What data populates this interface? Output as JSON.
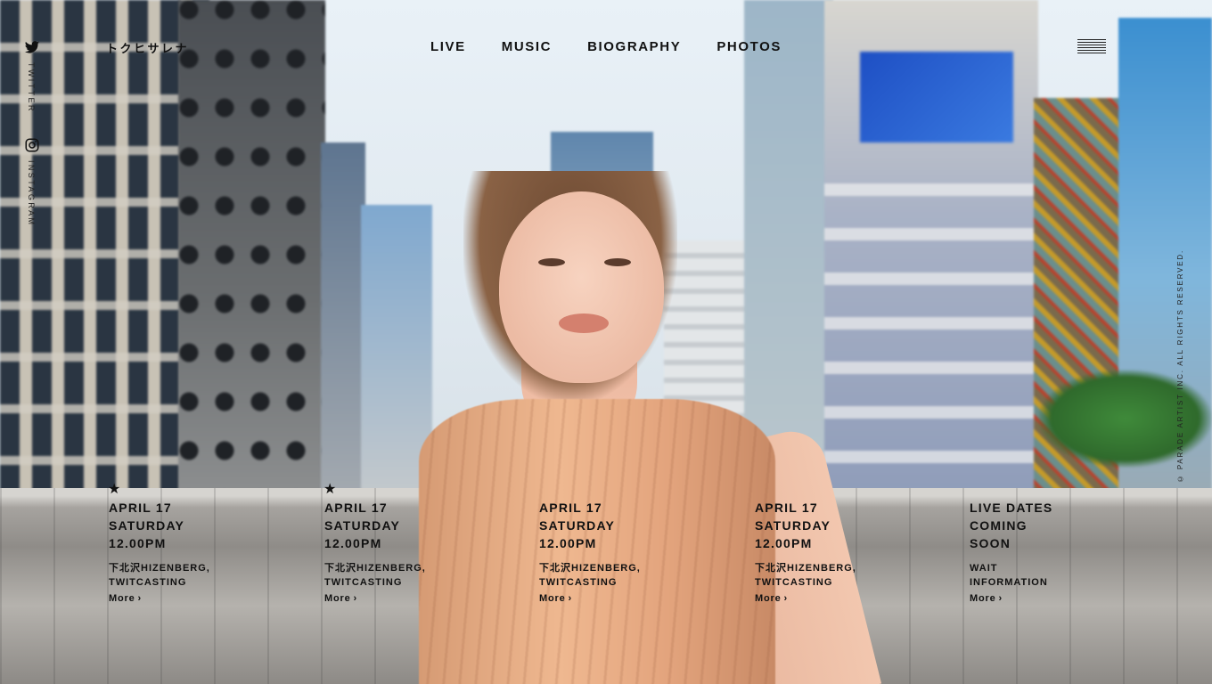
{
  "brand": {
    "logo": "トクヒサレナ"
  },
  "social": [
    {
      "icon": "twitter-icon",
      "label": "TWITTER"
    },
    {
      "icon": "instagram-icon",
      "label": "INSTAGRAM"
    }
  ],
  "nav": [
    {
      "label": "LIVE"
    },
    {
      "label": "MUSIC"
    },
    {
      "label": "BIOGRAPHY"
    },
    {
      "label": "PHOTOS"
    }
  ],
  "menu_icon": "hamburger-icon",
  "copyright": "© PARADE ARTIST INC. ALL RIGHTS RESERVED.",
  "events": [
    {
      "starred": true,
      "star_icon": "★",
      "date": "APRIL 17",
      "day": "SATURDAY",
      "time": "12.00PM",
      "venue1": "下北沢HIZENBERG,",
      "venue2": "TWITCASTING",
      "more": "More"
    },
    {
      "starred": true,
      "star_icon": "★",
      "date": "APRIL 17",
      "day": "SATURDAY",
      "time": "12.00PM",
      "venue1": "下北沢HIZENBERG,",
      "venue2": "TWITCASTING",
      "more": "More"
    },
    {
      "starred": false,
      "star_icon": "",
      "date": "APRIL 17",
      "day": "SATURDAY",
      "time": "12.00PM",
      "venue1": "下北沢HIZENBERG,",
      "venue2": "TWITCASTING",
      "more": "More"
    },
    {
      "starred": false,
      "star_icon": "",
      "date": "APRIL 17",
      "day": "SATURDAY",
      "time": "12.00PM",
      "venue1": "下北沢HIZENBERG,",
      "venue2": "TWITCASTING",
      "more": "More"
    },
    {
      "starred": false,
      "star_icon": "",
      "date": "LIVE DATES",
      "day": "COMING",
      "time": "SOON",
      "venue1": "WAIT",
      "venue2": "INFORMATION",
      "more": "More"
    }
  ],
  "colors": {
    "text": "#111111",
    "dress": "#e8a882",
    "sign": "#2a63d6"
  }
}
